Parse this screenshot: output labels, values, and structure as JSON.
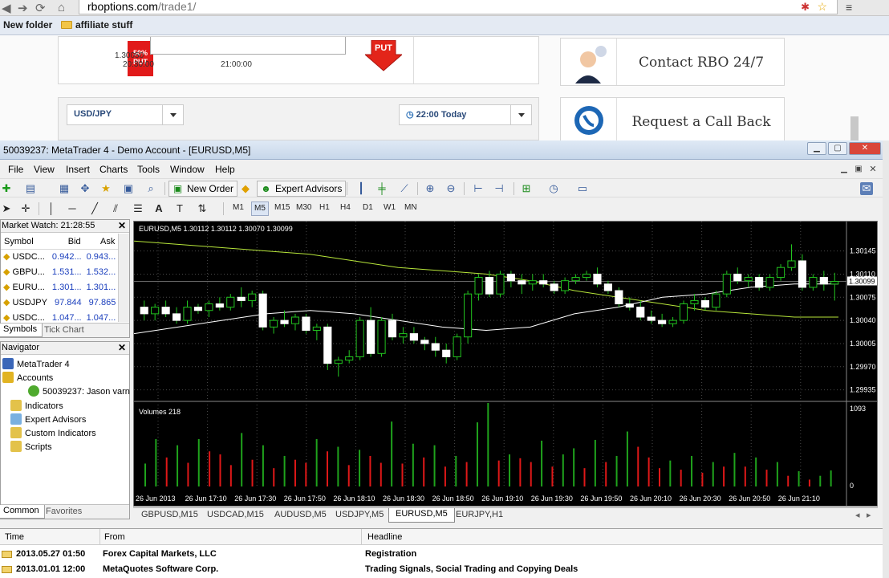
{
  "browser": {
    "url_host": "rboptions.com",
    "url_path": "/trade1/",
    "bookmarks": [
      "New folder",
      "affiliate stuff"
    ]
  },
  "site": {
    "badge_pct": "50%",
    "badge_label": "PUT",
    "put_label": "PUT",
    "mini_price": "1.30050",
    "mini_times": [
      "20:30:00",
      "21:00:00"
    ],
    "asset_select": "USD/JPY",
    "expiry_select": "22:00 Today",
    "contact_label": "Contact RBO 24/7",
    "callback_label": "Request a Call Back"
  },
  "mt4": {
    "title": "50039237: MetaTrader 4 - Demo Account - [EURUSD,M5]",
    "menu": [
      "File",
      "View",
      "Insert",
      "Charts",
      "Tools",
      "Window",
      "Help"
    ],
    "new_order_label": "New Order",
    "expert_advisors_label": "Expert Advisors",
    "timeframes": [
      "M1",
      "M5",
      "M15",
      "M30",
      "H1",
      "H4",
      "D1",
      "W1",
      "MN"
    ],
    "active_timeframe": "M5",
    "market_watch": {
      "title": "Market Watch: 21:28:55",
      "columns": [
        "Symbol",
        "Bid",
        "Ask"
      ],
      "rows": [
        {
          "symbol": "USDC...",
          "bid": "0.942...",
          "ask": "0.943..."
        },
        {
          "symbol": "GBPU...",
          "bid": "1.531...",
          "ask": "1.532..."
        },
        {
          "symbol": "EURU...",
          "bid": "1.301...",
          "ask": "1.301..."
        },
        {
          "symbol": "USDJPY",
          "bid": "97.844",
          "ask": "97.865"
        },
        {
          "symbol": "USDC...",
          "bid": "1.047...",
          "ask": "1.047..."
        }
      ],
      "tabs": [
        "Symbols",
        "Tick Chart"
      ]
    },
    "navigator": {
      "title": "Navigator",
      "items": [
        "MetaTrader 4",
        "Accounts",
        "50039237: Jason varn",
        "Indicators",
        "Expert Advisors",
        "Custom Indicators",
        "Scripts"
      ],
      "tabs": [
        "Common",
        "Favorites"
      ]
    },
    "chart_tabs": [
      "GBPUSD,M15",
      "USDCAD,M15",
      "AUDUSD,M5",
      "USDJPY,M5",
      "EURUSD,M5",
      "EURJPY,H1"
    ],
    "active_chart_tab": "EURUSD,M5",
    "news": {
      "columns": [
        "Time",
        "From",
        "Headline"
      ],
      "rows": [
        {
          "time": "2013.05.27 01:50",
          "from": "Forex Capital Markets, LLC",
          "headline": "Registration"
        },
        {
          "time": "2013.01.01 12:00",
          "from": "MetaQuotes Software Corp.",
          "headline": "Trading Signals, Social Trading and Copying Deals"
        }
      ]
    }
  },
  "chart_data": {
    "type": "candlestick",
    "symbol_header": "EURUSD,M5  1.30112 1.30112 1.30070 1.30099",
    "current_price": "1.30099",
    "y_ticks": [
      "1.30145",
      "1.30110",
      "1.30075",
      "1.30040",
      "1.30005",
      "1.29970",
      "1.29935"
    ],
    "ylim": [
      1.2992,
      1.3017
    ],
    "x_labels": [
      "26 Jun 2013",
      "26 Jun 17:10",
      "26 Jun 17:30",
      "26 Jun 17:50",
      "26 Jun 18:10",
      "26 Jun 18:30",
      "26 Jun 18:50",
      "26 Jun 19:10",
      "26 Jun 19:30",
      "26 Jun 19:50",
      "26 Jun 20:10",
      "26 Jun 20:30",
      "26 Jun 20:50",
      "26 Jun 21:10"
    ],
    "candles": [
      [
        1.3006,
        1.3007,
        1.3004,
        1.3005
      ],
      [
        1.3005,
        1.30065,
        1.3004,
        1.3006
      ],
      [
        1.3006,
        1.3007,
        1.30045,
        1.3005
      ],
      [
        1.3005,
        1.3006,
        1.30035,
        1.3004
      ],
      [
        1.3004,
        1.3007,
        1.30035,
        1.3006
      ],
      [
        1.3006,
        1.30065,
        1.3005,
        1.30055
      ],
      [
        1.30055,
        1.3007,
        1.30045,
        1.30065
      ],
      [
        1.30065,
        1.30075,
        1.30055,
        1.3006
      ],
      [
        1.3006,
        1.3008,
        1.30055,
        1.30075
      ],
      [
        1.30075,
        1.3009,
        1.3006,
        1.3007
      ],
      [
        1.3007,
        1.30085,
        1.3006,
        1.3008
      ],
      [
        1.3008,
        1.30085,
        1.30025,
        1.3003
      ],
      [
        1.3003,
        1.30045,
        1.3002,
        1.3004
      ],
      [
        1.3004,
        1.30055,
        1.3003,
        1.30035
      ],
      [
        1.30035,
        1.3005,
        1.30025,
        1.30045
      ],
      [
        1.30045,
        1.3005,
        1.3002,
        1.30025
      ],
      [
        1.30025,
        1.30035,
        1.3001,
        1.3003
      ],
      [
        1.3003,
        1.30035,
        1.29965,
        1.29975
      ],
      [
        1.29975,
        1.29985,
        1.29955,
        1.2998
      ],
      [
        1.2998,
        1.29995,
        1.29975,
        1.29985
      ],
      [
        1.29985,
        1.30045,
        1.2998,
        1.3004
      ],
      [
        1.3004,
        1.3006,
        1.29985,
        1.2999
      ],
      [
        1.2999,
        1.30045,
        1.29985,
        1.3004
      ],
      [
        1.3004,
        1.3005,
        1.3001,
        1.30015
      ],
      [
        1.30015,
        1.3003,
        1.30005,
        1.3002
      ],
      [
        1.3002,
        1.3003,
        1.30005,
        1.3001
      ],
      [
        1.3001,
        1.30015,
        1.29995,
        1.30005
      ],
      [
        1.30005,
        1.30015,
        1.29985,
        1.29995
      ],
      [
        1.29995,
        1.30005,
        1.29975,
        1.29985
      ],
      [
        1.29985,
        1.3002,
        1.2998,
        1.30015
      ],
      [
        1.30015,
        1.30085,
        1.30005,
        1.3008
      ],
      [
        1.3008,
        1.3011,
        1.3007,
        1.30105
      ],
      [
        1.30105,
        1.30115,
        1.30075,
        1.3008
      ],
      [
        1.3008,
        1.30115,
        1.30075,
        1.3011
      ],
      [
        1.3011,
        1.30115,
        1.3009,
        1.301
      ],
      [
        1.301,
        1.3011,
        1.3008,
        1.30095
      ],
      [
        1.30095,
        1.3011,
        1.30085,
        1.301
      ],
      [
        1.301,
        1.3011,
        1.3009,
        1.30095
      ],
      [
        1.30095,
        1.301,
        1.3008,
        1.30085
      ],
      [
        1.30085,
        1.30105,
        1.3008,
        1.301
      ],
      [
        1.301,
        1.3011,
        1.30095,
        1.30105
      ],
      [
        1.30105,
        1.30115,
        1.301,
        1.3011
      ],
      [
        1.3011,
        1.3012,
        1.3009,
        1.30095
      ],
      [
        1.30095,
        1.301,
        1.3008,
        1.30085
      ],
      [
        1.30085,
        1.3009,
        1.3006,
        1.30065
      ],
      [
        1.30065,
        1.30075,
        1.30055,
        1.3006
      ],
      [
        1.3006,
        1.3007,
        1.3004,
        1.30045
      ],
      [
        1.30045,
        1.30055,
        1.30035,
        1.3004
      ],
      [
        1.3004,
        1.3005,
        1.3003,
        1.30035
      ],
      [
        1.30035,
        1.30045,
        1.3003,
        1.3004
      ],
      [
        1.3004,
        1.3007,
        1.30035,
        1.30065
      ],
      [
        1.30065,
        1.3008,
        1.30055,
        1.3007
      ],
      [
        1.3007,
        1.30075,
        1.30055,
        1.3006
      ],
      [
        1.3006,
        1.30085,
        1.30055,
        1.3008
      ],
      [
        1.3008,
        1.30115,
        1.30075,
        1.3011
      ],
      [
        1.3011,
        1.3012,
        1.30095,
        1.301
      ],
      [
        1.301,
        1.3011,
        1.3009,
        1.30105
      ],
      [
        1.30105,
        1.3011,
        1.30085,
        1.3009
      ],
      [
        1.3009,
        1.3011,
        1.30085,
        1.30105
      ],
      [
        1.30105,
        1.30125,
        1.301,
        1.3012
      ],
      [
        1.3012,
        1.30155,
        1.30115,
        1.3013
      ],
      [
        1.3013,
        1.3014,
        1.30085,
        1.3009
      ],
      [
        1.3009,
        1.3011,
        1.30085,
        1.30105
      ],
      [
        1.30105,
        1.30115,
        1.30085,
        1.30095
      ],
      [
        1.30095,
        1.30112,
        1.3007,
        1.30099
      ]
    ],
    "ma_fast": [
      1.3002,
      1.3003,
      1.3004,
      1.3005,
      1.30055,
      1.3005,
      1.3004,
      1.3003,
      1.30025,
      1.3003,
      1.3005,
      1.3006,
      1.30075,
      1.3008,
      1.3009,
      1.30095,
      1.30095
    ],
    "ma_slow": [
      1.3016,
      1.30155,
      1.3015,
      1.30145,
      1.3014,
      1.3013,
      1.3012,
      1.30115,
      1.3011,
      1.301,
      1.30085,
      1.30075,
      1.30065,
      1.30055,
      1.3005,
      1.30045,
      1.30045
    ],
    "volumes_label": "Volumes 218",
    "volume_ticks": [
      "1093",
      "0"
    ],
    "volumes": [
      300,
      620,
      380,
      540,
      310,
      620,
      460,
      420,
      280,
      700,
      350,
      540,
      240,
      400,
      350,
      310,
      620,
      460,
      520,
      280,
      480,
      400,
      310,
      850,
      300,
      560,
      380,
      540,
      260,
      400,
      320,
      840,
      1093,
      340,
      420,
      370,
      320,
      600,
      260,
      420,
      500,
      240,
      610,
      320,
      400,
      720,
      520,
      380,
      240,
      340,
      220,
      400,
      180,
      320,
      260,
      440,
      260,
      380,
      220,
      320,
      140,
      200,
      90,
      140,
      210
    ]
  }
}
